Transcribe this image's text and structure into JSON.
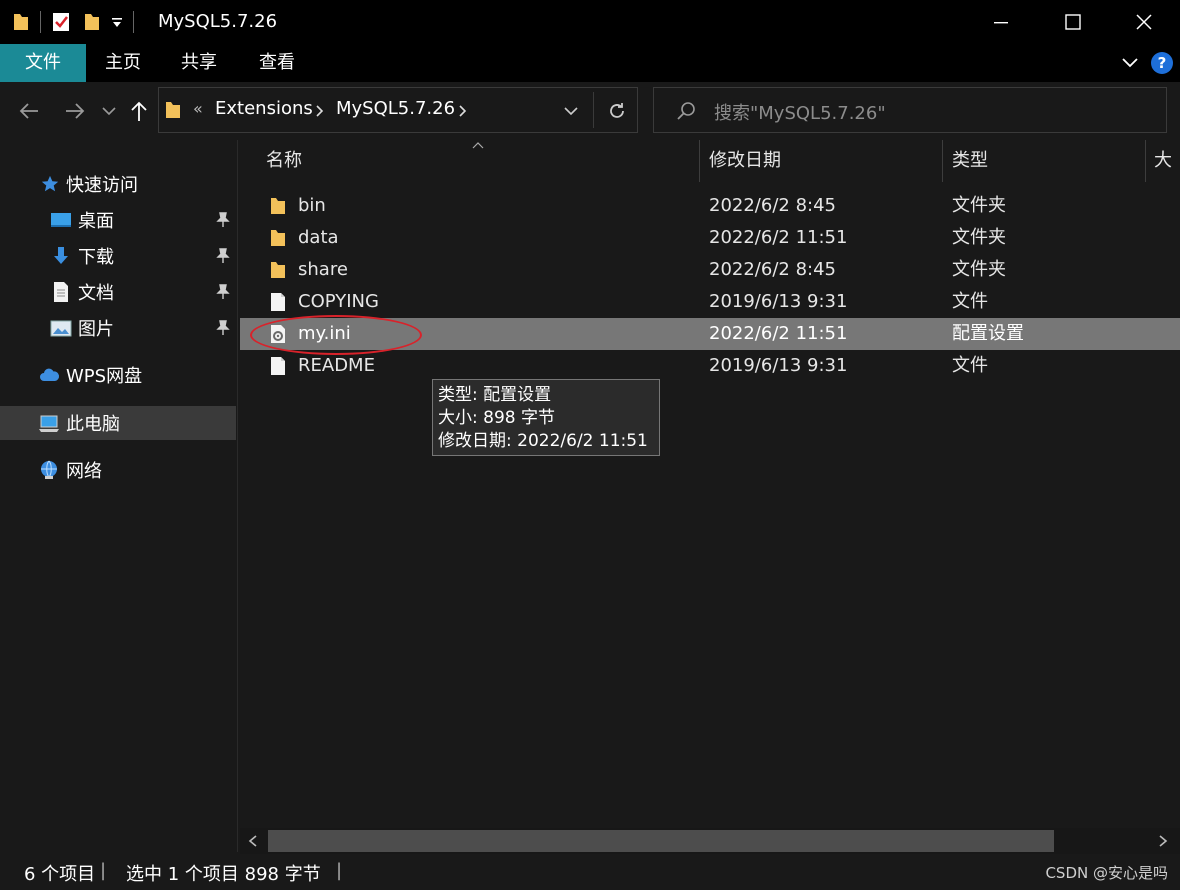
{
  "window": {
    "title": "MySQL5.7.26"
  },
  "ribbon": {
    "tabs": [
      "文件",
      "主页",
      "共享",
      "查看"
    ]
  },
  "address": {
    "overflow_marker": "«",
    "crumbs": [
      "Extensions",
      "MySQL5.7.26"
    ]
  },
  "search": {
    "placeholder": "搜索\"MySQL5.7.26\""
  },
  "navpane": {
    "quick_access": "快速访问",
    "items": [
      {
        "label": "桌面",
        "icon": "desktop-icon",
        "pinned": true
      },
      {
        "label": "下载",
        "icon": "download-icon",
        "pinned": true
      },
      {
        "label": "文档",
        "icon": "document-icon",
        "pinned": true
      },
      {
        "label": "图片",
        "icon": "picture-icon",
        "pinned": true
      }
    ],
    "wps": "WPS网盘",
    "this_pc": "此电脑",
    "network": "网络"
  },
  "columns": {
    "name": "名称",
    "modified": "修改日期",
    "type": "类型",
    "size": "大小"
  },
  "files": [
    {
      "name": "bin",
      "modified": "2022/6/2 8:45",
      "type": "文件夹",
      "icon": "folder-icon"
    },
    {
      "name": "data",
      "modified": "2022/6/2 11:51",
      "type": "文件夹",
      "icon": "folder-icon"
    },
    {
      "name": "share",
      "modified": "2022/6/2 8:45",
      "type": "文件夹",
      "icon": "folder-icon"
    },
    {
      "name": "COPYING",
      "modified": "2019/6/13 9:31",
      "type": "文件",
      "icon": "file-icon"
    },
    {
      "name": "my.ini",
      "modified": "2022/6/2 11:51",
      "type": "配置设置",
      "icon": "settings-file-icon",
      "selected": true
    },
    {
      "name": "README",
      "modified": "2019/6/13 9:31",
      "type": "文件",
      "icon": "file-icon"
    }
  ],
  "tooltip": {
    "line1": "类型: 配置设置",
    "line2": "大小: 898 字节",
    "line3": "修改日期: 2022/6/2 11:51"
  },
  "status": {
    "count": "6 个项目",
    "selected": "选中 1 个项目  898 字节",
    "watermark": "CSDN @安心是吗"
  },
  "colors": {
    "file_tab": "#1b8a96",
    "selection": "#777777",
    "annotation": "#d9222a",
    "folder": "#f3c15a",
    "help": "#1e6fd9"
  }
}
